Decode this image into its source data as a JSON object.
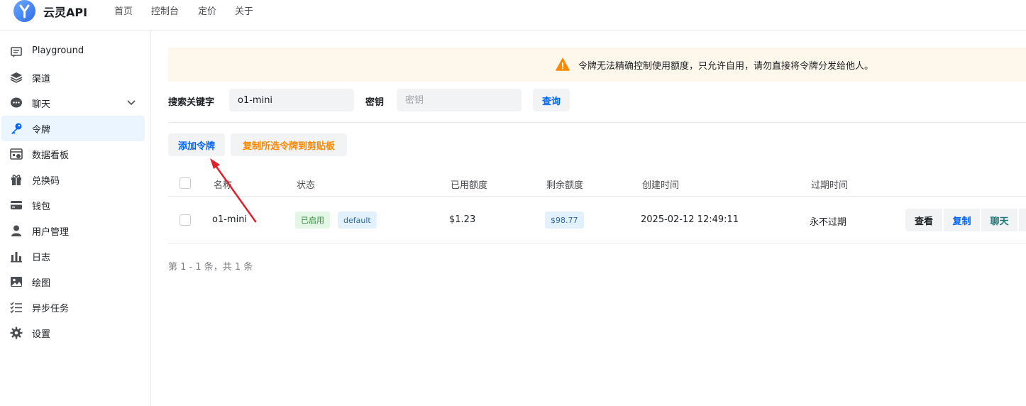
{
  "app": {
    "name": "云灵API",
    "logo_letter": "Y"
  },
  "nav": [
    "首页",
    "控制台",
    "定价",
    "关于"
  ],
  "sidebar": {
    "items": [
      {
        "label": "Playground",
        "icon": "message-square-icon"
      },
      {
        "label": "渠道",
        "icon": "layers-icon"
      },
      {
        "label": "聊天",
        "icon": "chat-bubble-icon",
        "expandable": true
      },
      {
        "label": "令牌",
        "icon": "key-icon",
        "active": true
      },
      {
        "label": "数据看板",
        "icon": "calendar-chart-icon"
      },
      {
        "label": "兑换码",
        "icon": "gift-icon"
      },
      {
        "label": "钱包",
        "icon": "credit-card-icon"
      },
      {
        "label": "用户管理",
        "icon": "user-icon"
      },
      {
        "label": "日志",
        "icon": "bar-chart-icon"
      },
      {
        "label": "绘图",
        "icon": "image-icon"
      },
      {
        "label": "异步任务",
        "icon": "checklist-icon"
      },
      {
        "label": "设置",
        "icon": "gear-icon"
      }
    ]
  },
  "banner": {
    "text": "令牌无法精确控制使用额度，只允许自用，请勿直接将令牌分发给他人。",
    "icon": "warning-icon"
  },
  "search": {
    "keyword_label": "搜索关键字",
    "keyword_value": "o1-mini",
    "key_label": "密钥",
    "key_placeholder": "密钥",
    "query_button": "查询"
  },
  "toolbar": {
    "add_button": "添加令牌",
    "copy_button": "复制所选令牌到剪贴板"
  },
  "table": {
    "columns": [
      "名称",
      "状态",
      "已用额度",
      "剩余额度",
      "创建时间",
      "过期时间"
    ],
    "rows": [
      {
        "name": "o1-mini",
        "status": "已启用",
        "group": "default",
        "used": "$1.23",
        "remaining": "$98.77",
        "created": "2025-02-12 12:49:11",
        "expires": "永不过期",
        "actions": [
          "查看",
          "复制",
          "聊天"
        ]
      }
    ]
  },
  "pagination": {
    "text": "第 1 - 1 条，共 1 条"
  },
  "colors": {
    "primary": "#0064fa",
    "warning": "#fc8800",
    "annotation_arrow": "#e0212b",
    "active_bg": "#eaf5ff"
  }
}
